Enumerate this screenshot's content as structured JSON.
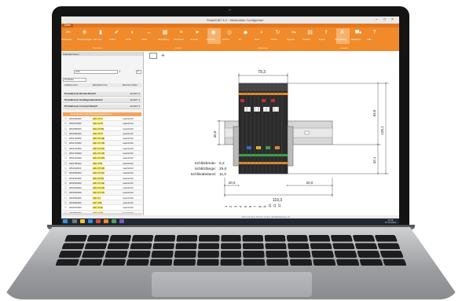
{
  "window": {
    "title": "SmartCAD 3.4 - Weidmüller Configurator",
    "file_tab": "Datei"
  },
  "ribbon": {
    "buttons": [
      {
        "label": "Ausblenden",
        "icon": "cut-icon"
      },
      {
        "label": "Bauteil einfügen",
        "icon": "insert-icon"
      },
      {
        "label": "Klemmen",
        "icon": "terminal-icon"
      },
      {
        "label": "Prüfen",
        "icon": "check-icon"
      },
      {
        "label": "Farbe",
        "icon": "color-icon"
      },
      {
        "label": "Maße",
        "icon": "dimension-icon"
      },
      {
        "label": "Bestückung",
        "icon": "assembly-icon"
      },
      {
        "label": "Ausrichten",
        "icon": "align-icon"
      },
      {
        "label": "Auswahl",
        "icon": "cursor-icon"
      },
      {
        "label": "Markieren",
        "icon": "marker-icon"
      },
      {
        "label": "Ansicht",
        "icon": "view-icon"
      },
      {
        "label": "3D",
        "icon": "cube-icon"
      },
      {
        "label": "Zoom",
        "icon": "zoom-icon"
      },
      {
        "label": "Drehen",
        "icon": "rotate-icon"
      },
      {
        "label": "Spiegeln",
        "icon": "mirror-icon"
      },
      {
        "label": "Drucken",
        "icon": "print-icon"
      },
      {
        "label": "Export",
        "icon": "export-icon"
      },
      {
        "label": "Beschriftung",
        "icon": "label-icon"
      },
      {
        "label": "Bestellung",
        "icon": "cart-icon"
      },
      {
        "label": "Hilfe",
        "icon": "help-icon"
      }
    ],
    "groups": [
      "Bearbeiten",
      "Ansicht",
      "Werkzeuge",
      "Ausgabe"
    ]
  },
  "left_panel": {
    "title": "Katalogbrowser",
    "search_value": "A4C",
    "filter_label": "Produkte",
    "col_headers": [
      "Artikelnummer",
      "Materialnummer",
      "Benutzer-Artikel"
    ],
    "groups": [
      {
        "label": "Produktserie Klemm-Modell",
        "count": "Anzahl: 6"
      },
      {
        "label": "Produktserie Schaltgerätezubehör",
        "count": "Anzahl: 4"
      },
      {
        "label": "Produktserie Connect-Modell",
        "count": "Anzahl: 3"
      }
    ],
    "table_header": "Produktserie Durchgangsreihenklemme",
    "rows": [
      {
        "no": "2051660000",
        "type": "A4C 2.5 V",
        "code": "max2LV4O"
      },
      {
        "no": "2051670000",
        "type": "A4C 2.5 B",
        "code": "max2LV4O"
      },
      {
        "no": "2051680000",
        "type": "A4C 2.5 BL",
        "code": "max2LV4O"
      },
      {
        "no": "2051690000",
        "type": "A4C 2.5 R",
        "code": "max2LV4O"
      },
      {
        "no": "2051700000",
        "type": "A4C 2.5 GE",
        "code": "max2LV4O"
      },
      {
        "no": "2051710000",
        "type": "A4C 2.5 OR",
        "code": "max2LV4O"
      },
      {
        "no": "2051720000",
        "type": "A4C 2.5 GN",
        "code": "max2LV4O"
      },
      {
        "no": "2051730000",
        "type": "A4C 2.5 GR",
        "code": "max2LV4O"
      },
      {
        "no": "2051740000",
        "type": "A4C 2.5 WS",
        "code": "max2LV4O"
      },
      {
        "no": "1991780000",
        "type": "A4C 4 PE",
        "code": "max2LV4O"
      },
      {
        "no": "2051190000",
        "type": "A4C 2.5 OR",
        "code": "max2LV4O"
      },
      {
        "no": "2051500000",
        "type": "A4C 2.5 DV",
        "code": "max2LV4O"
      },
      {
        "no": "2051510000",
        "type": "A4C 2.5 BL",
        "code": "max2LV4O"
      },
      {
        "no": "2051520000",
        "type": "A4C 2.5 GE",
        "code": "max2LV4O"
      },
      {
        "no": "2051530000",
        "type": "A4C 2.5 OR",
        "code": "max2LV4O"
      },
      {
        "no": "2051540000",
        "type": "A4C 2.5 GN",
        "code": "max2LV4O"
      },
      {
        "no": "2051550000",
        "type": "A4C 4 V",
        "code": "max2LV4O"
      },
      {
        "no": "2051560000",
        "type": "A4C 4 BL",
        "code": "max2LV4O"
      },
      {
        "no": "2051570000",
        "type": "A4C 4 GE",
        "code": "max2LV4O"
      },
      {
        "no": "2051580000",
        "type": "A4C 4 OR",
        "code": "max2LV4O"
      },
      {
        "no": "2051590000",
        "type": "A4C 4 GN",
        "code": "max2LV4O"
      },
      {
        "no": "2051600000",
        "type": "A4C 4 GR",
        "code": "max2LV4O"
      },
      {
        "no": "2051610000",
        "type": "A4C 4 WS",
        "code": "max2LV4O"
      },
      {
        "no": "2051620000",
        "type": "A4C 4 PE",
        "code": "max2LV4O"
      },
      {
        "no": "2051630000",
        "type": "A4C 6 V",
        "code": "max2LV4O"
      },
      {
        "no": "2051640000",
        "type": "A4C 6 BL",
        "code": "max2LV4O"
      }
    ],
    "bottom_tab": "Produkte"
  },
  "drawing": {
    "dim_top": "79,3",
    "dim_bottom": "119,3",
    "dim_left": "35,0",
    "dim_right_top": "63,0",
    "dim_right_full": "128,1",
    "dim_right_mid": "42,1",
    "dim_end_left": "20,0",
    "dim_end_right": "20,0",
    "slot_width_label": "Schlitzbreite:",
    "slot_width_value": "5,2",
    "slot_length_label": "Schlitzlänge:",
    "slot_length_value": "25,0",
    "slot_spacing_label": "Schlitzabstand:",
    "slot_spacing_value": "11,0",
    "terminal_numbers": [
      "1",
      "2",
      "3",
      "4",
      "5",
      "6",
      "7",
      "8",
      "9",
      "10",
      "11",
      "12"
    ]
  },
  "status": {
    "text": "ID 0 | 1,5 mm² | 2,5 mm² | 4 mm² | Anzahl Klemmen: 12"
  },
  "taskbar": {
    "time": "10:46",
    "date": "07.03.2019"
  },
  "colors": {
    "accent": "#f08a2a",
    "ribbon_dark": "#e4781e",
    "highlight": "#fff36a"
  }
}
